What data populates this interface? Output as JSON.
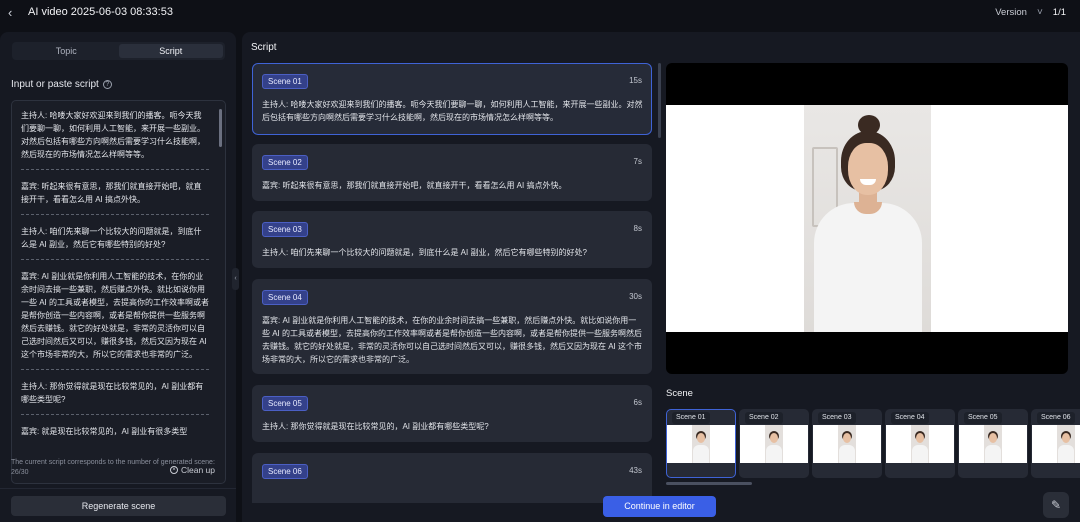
{
  "header": {
    "back_icon": "chevron-left-icon",
    "title": "AI video 2025-06-03 08:33:53",
    "version_label": "Version",
    "version_chevron": "chevron-down-icon",
    "page": "1/1"
  },
  "left_panel": {
    "tabs": [
      {
        "label": "Topic",
        "active": false
      },
      {
        "label": "Script",
        "active": true
      }
    ],
    "input_label": "Input or paste script",
    "help_icon": "question-circle-icon",
    "script_segments": [
      "主持人: 哈喽大家好欢迎来到我们的播客。呃今天我们要聊一聊，如何利用人工智能，来开展一些副业。对然后包括有哪些方向啊然后需要学习什么技能啊，然后现在的市场情况怎么样啊等等。",
      "嘉宾: 听起来很有意思，那我们就直接开始吧，就直接开干，看看怎么用 AI 搞点外快。",
      "主持人: 咱们先来聊一个比较大的问题就是，到底什么是 AI 副业，然后它有哪些特别的好处?",
      "嘉宾: AI 副业就是你利用人工智能的技术，在你的业余时间去搞一些兼职，然后赚点外快。就比如说你用一些 AI 的工具或者模型，去提高你的工作效率啊或者是帮你创造一些内容啊，或者是帮你提供一些服务啊然后去赚钱。就它的好处就是，非常的灵活你可以自己选时间然后又可以，赚很多钱，然后又因为现在 AI 这个市场非常的大，所以它的需求也非常的广泛。",
      "主持人: 那你觉得就是现在比较常见的，AI 副业都有哪些类型呢?",
      "嘉宾: 就是现在比较常见的，AI 副业有很多类型"
    ],
    "cleanup_label": "Clean up",
    "cleanup_icon": "clear-circle-icon",
    "note": "The current script corresponds to the number of generated scene: 26/30",
    "regenerate_label": "Regenerate scene",
    "collapse_icon": "chevron-left-icon"
  },
  "main": {
    "script_heading": "Script",
    "scenes": [
      {
        "label": "Scene 01",
        "duration": "15s",
        "text": "主持人: 哈喽大家好欢迎来到我们的播客。呃今天我们要聊一聊，如何利用人工智能，来开展一些副业。对然后包括有哪些方向啊然后需要学习什么技能啊，然后现在的市场情况怎么样啊等等。"
      },
      {
        "label": "Scene 02",
        "duration": "7s",
        "text": "嘉宾: 听起来很有意思，那我们就直接开始吧，就直接开干，看看怎么用 AI 搞点外快。"
      },
      {
        "label": "Scene 03",
        "duration": "8s",
        "text": "主持人: 咱们先来聊一个比较大的问题就是，到底什么是 AI 副业，然后它有哪些特别的好处?"
      },
      {
        "label": "Scene 04",
        "duration": "30s",
        "text": "嘉宾: AI 副业就是你利用人工智能的技术，在你的业余时间去搞一些兼职，然后赚点外快。就比如说你用一些 AI 的工具或者模型，去提高你的工作效率啊或者是帮你创造一些内容啊，或者是帮你提供一些服务啊然后去赚钱。就它的好处就是，非常的灵活你可以自己选时间然后又可以，赚很多钱，然后又因为现在 AI 这个市场非常的大，所以它的需求也非常的广泛。"
      },
      {
        "label": "Scene 05",
        "duration": "6s",
        "text": "主持人: 那你觉得就是现在比较常见的，AI 副业都有哪些类型呢?"
      },
      {
        "label": "Scene 06",
        "duration": "43s",
        "text": ""
      }
    ],
    "scene_strip_label": "Scene",
    "thumbnails": [
      "Scene 01",
      "Scene 02",
      "Scene 03",
      "Scene 04",
      "Scene 05",
      "Scene 06"
    ],
    "continue_label": "Continue in editor",
    "edit_icon": "edit-note-icon"
  },
  "colors": {
    "accent": "#3a5fe6",
    "badge": "#34418a",
    "panel": "#161922",
    "background": "#0e1016"
  }
}
